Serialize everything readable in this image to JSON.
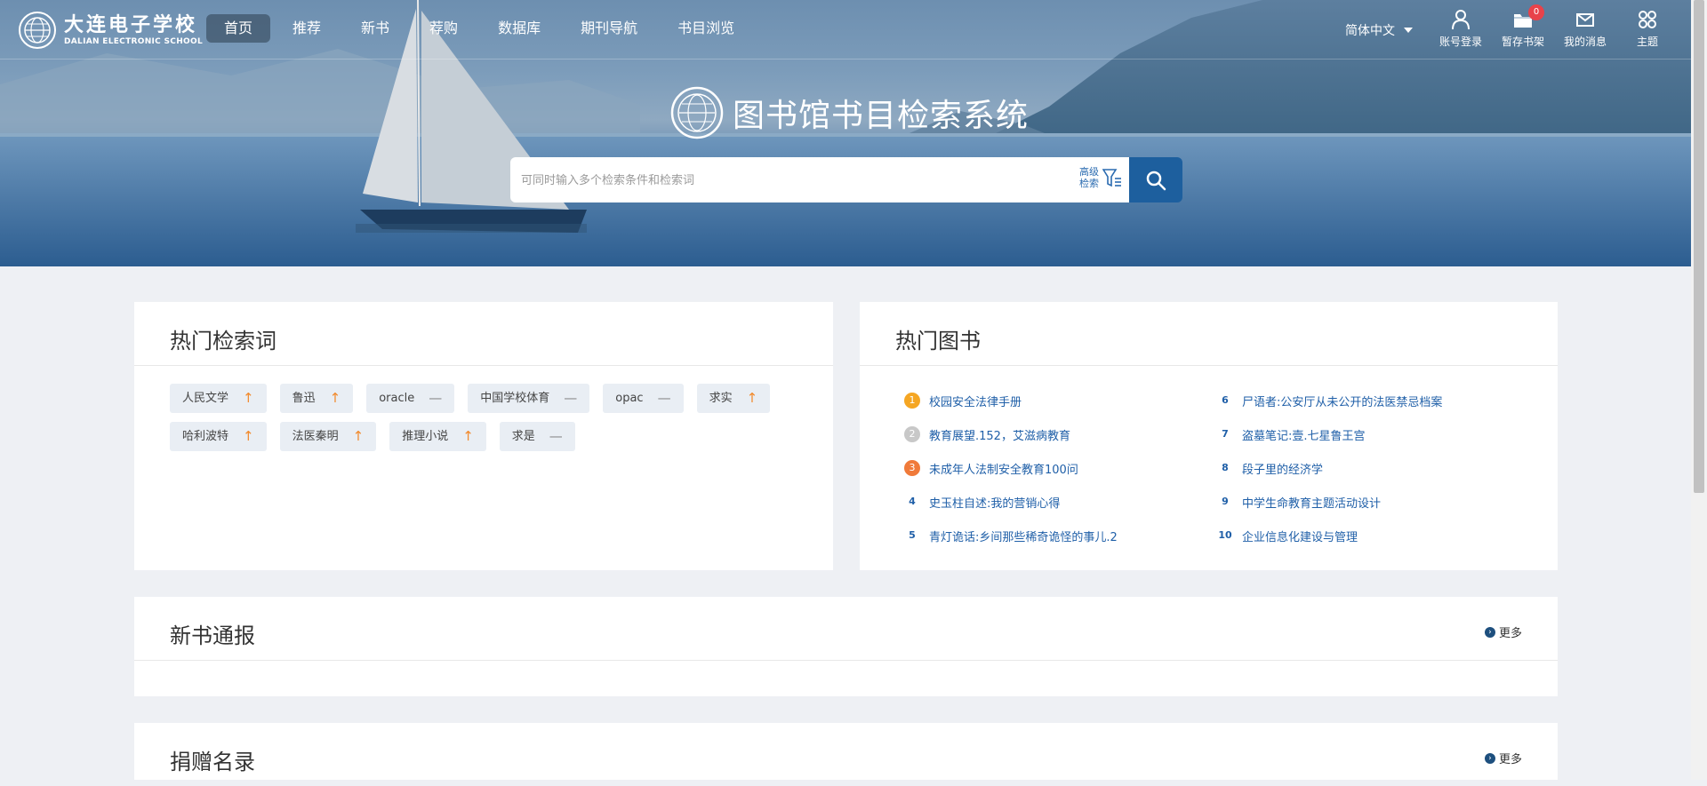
{
  "header": {
    "logo": {
      "cn": "大连电子学校",
      "en": "DALIAN ELECTRONIC SCHOOL"
    },
    "nav": [
      "首页",
      "推荐",
      "新书",
      "荐购",
      "数据库",
      "期刊导航",
      "书目浏览"
    ],
    "active_nav": "首页",
    "language": "简体中文",
    "tools": {
      "login": "账号登录",
      "shelf": "暂存书架",
      "shelf_count": "0",
      "messages": "我的消息",
      "theme": "主题"
    }
  },
  "hero": {
    "title": "图书馆书目检索系统",
    "search_placeholder": "可同时输入多个检索条件和检索词",
    "advanced_line1": "高级",
    "advanced_line2": "检索"
  },
  "hot_terms": {
    "title": "热门检索词",
    "items": [
      {
        "label": "人民文学",
        "trend": "up"
      },
      {
        "label": "鲁迅",
        "trend": "up"
      },
      {
        "label": "oracle",
        "trend": "flat"
      },
      {
        "label": "中国学校体育",
        "trend": "flat"
      },
      {
        "label": "opac",
        "trend": "flat"
      },
      {
        "label": "求实",
        "trend": "up"
      },
      {
        "label": "哈利波特",
        "trend": "up"
      },
      {
        "label": "法医秦明",
        "trend": "up"
      },
      {
        "label": "推理小说",
        "trend": "up"
      },
      {
        "label": "求是",
        "trend": "flat"
      }
    ]
  },
  "hot_books": {
    "title": "热门图书",
    "items": [
      {
        "rank": "1",
        "title": "校园安全法律手册"
      },
      {
        "rank": "2",
        "title": "教育展望.152，艾滋病教育"
      },
      {
        "rank": "3",
        "title": "未成年人法制安全教育100问"
      },
      {
        "rank": "4",
        "title": "史玉柱自述:我的营销心得"
      },
      {
        "rank": "5",
        "title": "青灯诡话:乡间那些稀奇诡怪的事儿.2"
      },
      {
        "rank": "6",
        "title": "尸语者:公安厅从未公开的法医禁忌档案"
      },
      {
        "rank": "7",
        "title": "盗墓笔记:壹.七星鲁王宫"
      },
      {
        "rank": "8",
        "title": "段子里的经济学"
      },
      {
        "rank": "9",
        "title": "中学生命教育主题活动设计"
      },
      {
        "rank": "10",
        "title": "企业信息化建设与管理"
      }
    ]
  },
  "new_books": {
    "title": "新书通报",
    "more": "更多"
  },
  "donations": {
    "title": "捐赠名录",
    "more": "更多"
  },
  "colors": {
    "accent": "#1d5f9e",
    "link": "#1f5fa8",
    "trend_up": "#f28a2c"
  },
  "icons": [
    "user-icon",
    "folder-icon",
    "mail-icon",
    "theme-grid-icon",
    "search-icon",
    "filter-icon"
  ]
}
